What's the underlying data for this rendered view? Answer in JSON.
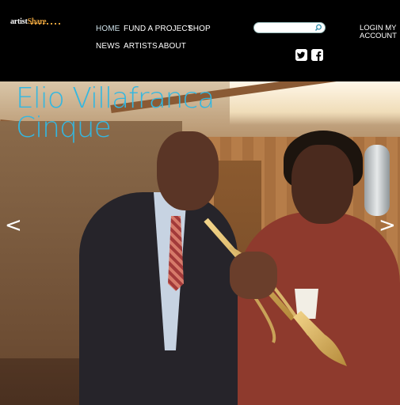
{
  "logo": {
    "text_main": "artist",
    "text_accent": "Share"
  },
  "nav": {
    "row1": [
      "HOME",
      "FUND A PROJECT",
      "SHOP"
    ],
    "row2": [
      "NEWS",
      "ARTISTS",
      "ABOUT"
    ],
    "active": "HOME"
  },
  "search": {
    "placeholder": "",
    "value": ""
  },
  "social": {
    "icons": [
      "twitter-icon",
      "facebook-icon"
    ]
  },
  "login": {
    "label": "LOGIN MY ACCOUNT"
  },
  "hero": {
    "title_line1": "Elio Villafranca",
    "title_line2": "Cinque",
    "prev_label": "<",
    "next_label": ">"
  },
  "colors": {
    "accent": "#34b7e0",
    "logo_accent": "#e8a33d"
  }
}
